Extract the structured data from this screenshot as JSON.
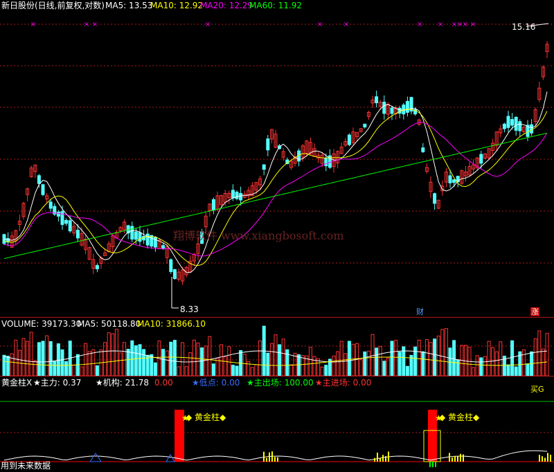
{
  "colors": {
    "background": "#000000",
    "up_candle": "#ff3232",
    "down_candle": "#54ffff",
    "ma5": "#ffffff",
    "ma10": "#ffff00",
    "ma20": "#ff00ff",
    "ma60": "#00ff00",
    "grid": "#b01818",
    "signal_bar": "#ff0000",
    "signal_label": "#ffff00"
  },
  "price_pane": {
    "title": "新日股份(日线,前复权,对数)",
    "ma5_label": "MA5: 13.53",
    "ma10_label": "MA10: 12.92",
    "ma20_label": "MA20: 12.29",
    "ma60_label": "MA60: 11.92",
    "high_label": "15.16",
    "low_label": "8.33",
    "watermark": "翔博软件 www.xiangbosoft.com",
    "badge_finance": "财",
    "badge_limit": "涨"
  },
  "volume_pane": {
    "volume_label": "VOLUME: 39173.30",
    "ma5_label": "MA5: 50118.80",
    "ma10_label": "MA10: 31866.10"
  },
  "indicator_pane": {
    "name": "黄金柱X",
    "main_force": "★主力: 0.37",
    "institution": "★机构: 21.78",
    "institution_extra": "0.00",
    "low_point": "★低点: 0.00",
    "main_exit": "★主出场: 100.00",
    "main_entry": "★主进场: 0.00",
    "right_marker": "买G",
    "signal_1": "◆ 黄金柱◆",
    "signal_2": "◆ 黄金柱◆",
    "footer": "用到未来数据"
  },
  "chart_data": {
    "type": "candlestick",
    "title": "新日股份(日线,前复权,对数)",
    "scale": "log",
    "price_range": [
      8.33,
      15.16
    ],
    "series": [
      {
        "name": "MA5",
        "value": 13.53
      },
      {
        "name": "MA10",
        "value": 12.92
      },
      {
        "name": "MA20",
        "value": 12.29
      },
      {
        "name": "MA60",
        "value": 11.92
      }
    ],
    "volume": {
      "VOLUME": 39173.3,
      "MA5": 50118.8,
      "MA10": 31866.1
    },
    "indicator": {
      "主力": 0.37,
      "机构": 21.78,
      "低点": 0.0,
      "主出场": 100.0,
      "主进场": 0.0
    }
  }
}
